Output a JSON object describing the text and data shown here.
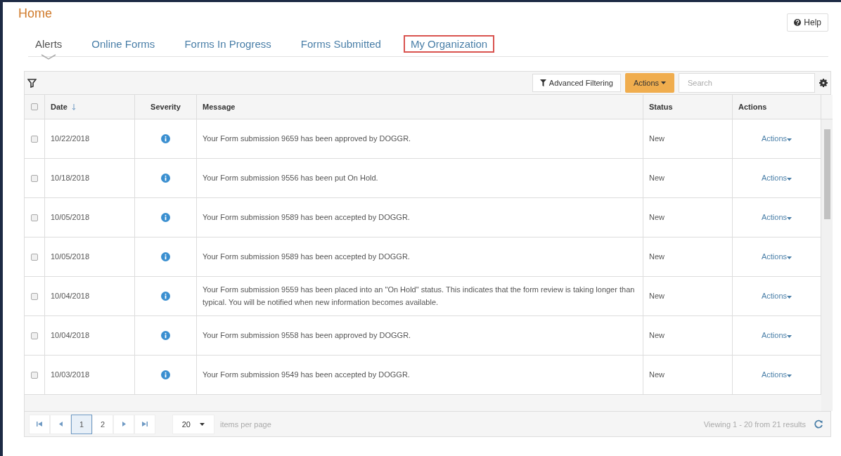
{
  "page": {
    "title": "Home",
    "help_button": "Help"
  },
  "tabs": [
    {
      "label": "Alerts",
      "selected": true,
      "highlighted": false
    },
    {
      "label": "Online Forms",
      "selected": false,
      "highlighted": false
    },
    {
      "label": "Forms In Progress",
      "selected": false,
      "highlighted": false
    },
    {
      "label": "Forms Submitted",
      "selected": false,
      "highlighted": false
    },
    {
      "label": "My Organization",
      "selected": false,
      "highlighted": true
    }
  ],
  "toolbar": {
    "advanced_filtering": "Advanced Filtering",
    "actions_button": "Actions",
    "search_placeholder": "Search"
  },
  "table": {
    "columns": [
      {
        "label": "Date",
        "sorted": true
      },
      {
        "label": "Severity",
        "sorted": false
      },
      {
        "label": "Message",
        "sorted": false
      },
      {
        "label": "Status",
        "sorted": false
      },
      {
        "label": "Actions",
        "sorted": false
      }
    ],
    "header_checked": false,
    "rows": [
      {
        "checked": false,
        "date": "10/22/2018",
        "message": "Your Form submission 9659 has been approved by DOGGR.",
        "status": "New",
        "action": "Actions"
      },
      {
        "checked": false,
        "date": "10/18/2018",
        "message": "Your Form submission 9556 has been put On Hold.",
        "status": "New",
        "action": "Actions"
      },
      {
        "checked": false,
        "date": "10/05/2018",
        "message": "Your Form submission 9589 has been accepted by DOGGR.",
        "status": "New",
        "action": "Actions"
      },
      {
        "checked": false,
        "date": "10/05/2018",
        "message": "Your Form submission 9589 has been accepted by DOGGR.",
        "status": "New",
        "action": "Actions"
      },
      {
        "checked": false,
        "date": "10/04/2018",
        "message": "Your Form submission 9559 has been placed into an \"On Hold\" status. This indicates that the form review is taking longer than typical. You will be notified when new information becomes available.",
        "status": "New",
        "action": "Actions"
      },
      {
        "checked": false,
        "date": "10/04/2018",
        "message": "Your Form submission 9558 has been approved by DOGGR.",
        "status": "New",
        "action": "Actions"
      },
      {
        "checked": false,
        "date": "10/03/2018",
        "message": "Your Form submission 9549 has been accepted by DOGGR.",
        "status": "New",
        "action": "Actions"
      }
    ]
  },
  "pager": {
    "pages": [
      {
        "label": "1",
        "selected": true
      },
      {
        "label": "2",
        "selected": false
      }
    ],
    "page_size": "20",
    "page_size_label": "items per page",
    "summary": "Viewing 1 - 20 from 21 results"
  }
}
